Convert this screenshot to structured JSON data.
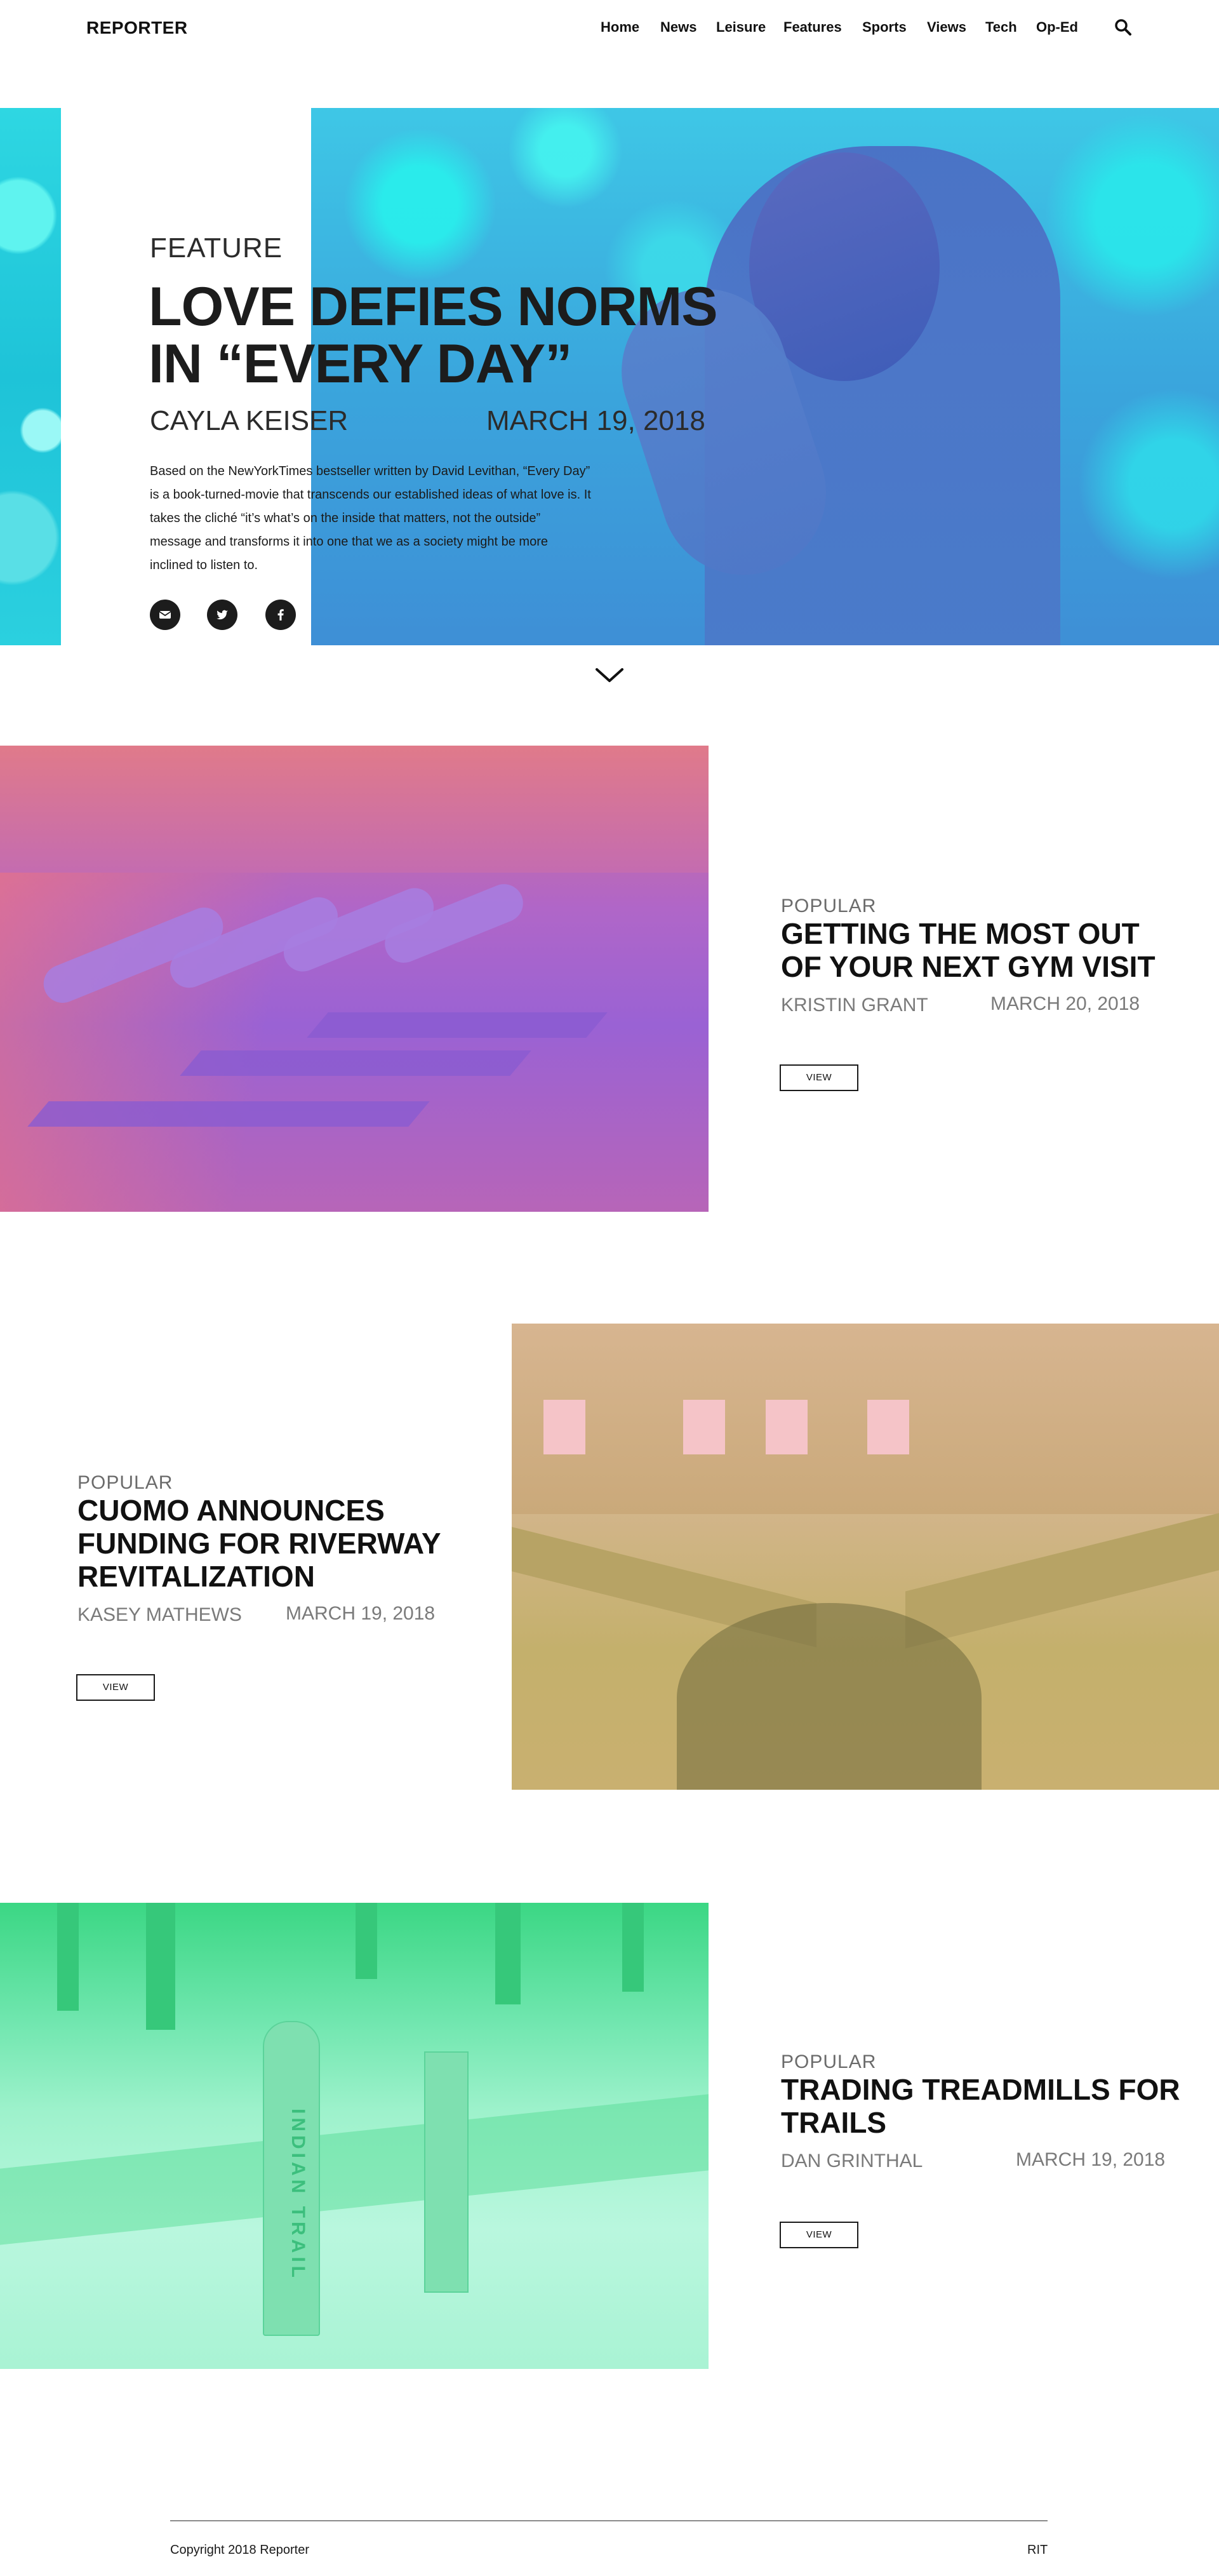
{
  "header": {
    "logo": "REPORTER",
    "nav": [
      "Home",
      "News",
      "Leisure",
      "Features",
      "Sports",
      "Views",
      "Tech",
      "Op-Ed"
    ],
    "search_icon": "search-icon"
  },
  "hero": {
    "category": "FEATURE",
    "title_line1": "LOVE DEFIES NORMS",
    "title_line2": "IN “EVERY DAY”",
    "author": "CAYLA KEISER",
    "date": "MARCH 19, 2018",
    "description": "Based on the NewYorkTimes bestseller written by David Levithan, “Every Day” is a book-turned-movie that transcends our established ideas of what love is. It takes the cliché “it’s what’s on the inside that matters, not the outside” message and transforms it into one that we as a society might be more inclined to listen to.",
    "social_icons": [
      "email-icon",
      "twitter-icon",
      "facebook-icon"
    ],
    "scroll_icon": "chevron-down-icon"
  },
  "articles": [
    {
      "category": "POPULAR",
      "title_lines": [
        "GETTING THE MOST OUT",
        "OF YOUR NEXT GYM VISIT"
      ],
      "author": "KRISTIN GRANT",
      "date": "MARCH 20, 2018",
      "button": "VIEW"
    },
    {
      "category": "POPULAR",
      "title_lines": [
        "CUOMO ANNOUNCES",
        "FUNDING FOR RIVERWAY",
        "REVITALIZATION"
      ],
      "author": "KASEY MATHEWS",
      "date": "MARCH 19, 2018",
      "button": "VIEW"
    },
    {
      "category": "POPULAR",
      "title_lines": [
        "TRADING TREADMILLS FOR",
        "TRAILS"
      ],
      "author": "DAN GRINTHAL",
      "date": "MARCH 19, 2018",
      "button": "VIEW",
      "image_sign_text": "INDIAN TRAIL"
    }
  ],
  "footer": {
    "copyright": "Copyright 2018 Reporter",
    "right_text": "RIT"
  },
  "colors": {
    "hero_tint": "#3e8fd6",
    "gym_tint": "#9a62d4",
    "river_tint": "#c4b06c",
    "trail_tint": "#9ef2cc",
    "text": "#1a1a1a"
  }
}
